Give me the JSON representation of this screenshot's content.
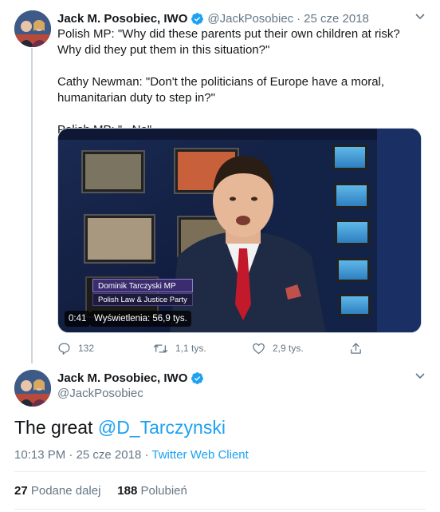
{
  "colors": {
    "accent": "#1da1f2",
    "text_primary": "#14171a",
    "text_secondary": "#657786",
    "border": "#e6ecf0"
  },
  "tweet": {
    "author_name": "Jack M. Posobiec, IWO",
    "handle": "@JackPosobiec",
    "separator": "·",
    "date": "25 cze 2018",
    "text_lines": [
      "Polish MP: \"Why did these parents put their own children at risk? Why did they put them in this situation?\"",
      "Cathy Newman: \"Don't the politicians of Europe have a moral, humanitarian duty to step in?\"",
      "Polish MP: \"...No\""
    ],
    "video": {
      "lower_third_name": "Dominik Tarczyski MP",
      "lower_third_party": "Polish Law & Justice Party",
      "duration": "0:41",
      "views": "Wyświetlenia: 56,9 tys."
    },
    "actions": {
      "replies": "132",
      "retweets": "1,1 tys.",
      "likes": "2,9 tys."
    }
  },
  "reply": {
    "author_name": "Jack M. Posobiec, IWO",
    "handle": "@JackPosobiec",
    "text_prefix": "The great ",
    "mention": "@D_Tarczynski",
    "time": "10:13 PM",
    "meta_separator": "·",
    "date": "25 cze 2018",
    "client": "Twitter Web Client",
    "retweets_count": "27",
    "retweets_label": "Podane dalej",
    "likes_count": "188",
    "likes_label": "Polubień"
  }
}
